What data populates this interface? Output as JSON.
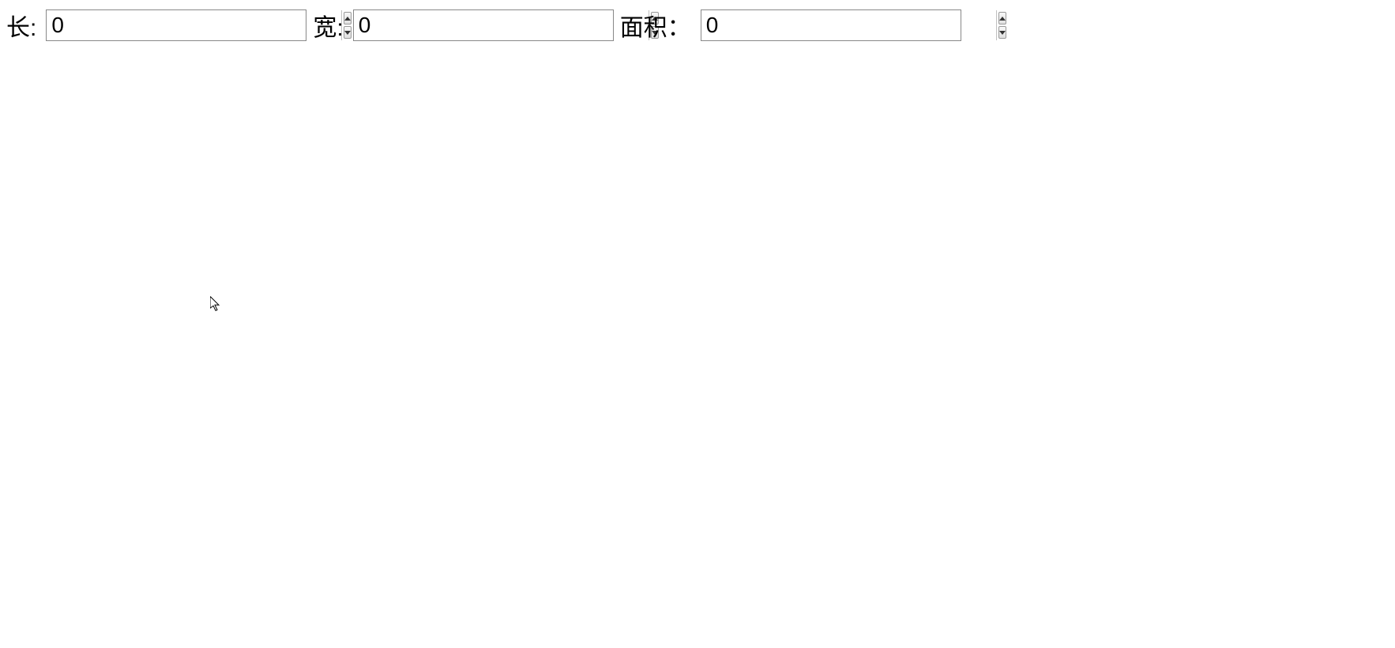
{
  "fields": {
    "length": {
      "label": "长:",
      "value": "0"
    },
    "width": {
      "label": "宽:",
      "value": "0"
    },
    "area": {
      "label": "面积：",
      "value": "0"
    }
  }
}
